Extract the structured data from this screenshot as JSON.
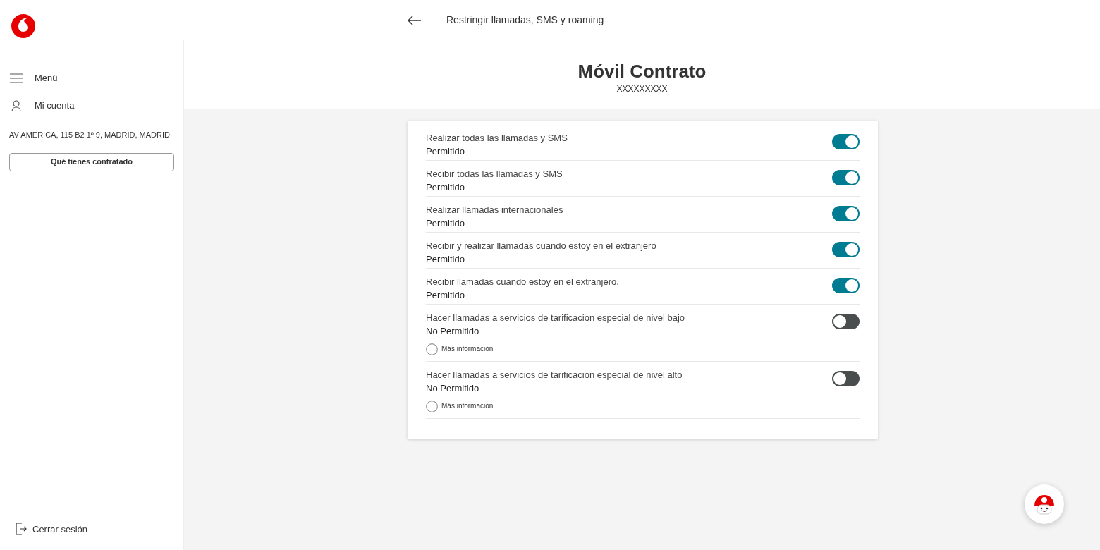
{
  "header": {
    "title": "Restringir llamadas, SMS y roaming"
  },
  "sidebar": {
    "items": [
      {
        "label": "Menú",
        "kind": "menu"
      },
      {
        "label": "Mi cuenta",
        "kind": "user"
      }
    ],
    "address": "AV AMERICA, 115 B2 1º 9, MADRID, MADRID",
    "button": "Qué tienes contratado",
    "logout": "Cerrar sesión"
  },
  "product": {
    "title": "Móvil Contrato",
    "number": "XXXXXXXXX"
  },
  "settings": [
    {
      "label": "Realizar todas las llamadas y SMS",
      "status": "Permitido",
      "on": true
    },
    {
      "label": "Recibir todas las llamadas y SMS",
      "status": "Permitido",
      "on": true
    },
    {
      "label": "Realizar llamadas internacionales",
      "status": "Permitido",
      "on": true
    },
    {
      "label": "Recibir y realizar llamadas cuando estoy en el extranjero",
      "status": "Permitido",
      "on": true
    },
    {
      "label": "Recibir llamadas cuando estoy en el extranjero.",
      "status": "Permitido",
      "on": true
    },
    {
      "label": "Hacer llamadas a servicios de tarificacion especial de nivel bajo",
      "status": "No Permitido",
      "on": false,
      "info": "Más información"
    },
    {
      "label": "Hacer llamadas a servicios de tarificacion especial de nivel alto",
      "status": "No Permitido",
      "on": false,
      "info": "Más información"
    }
  ]
}
